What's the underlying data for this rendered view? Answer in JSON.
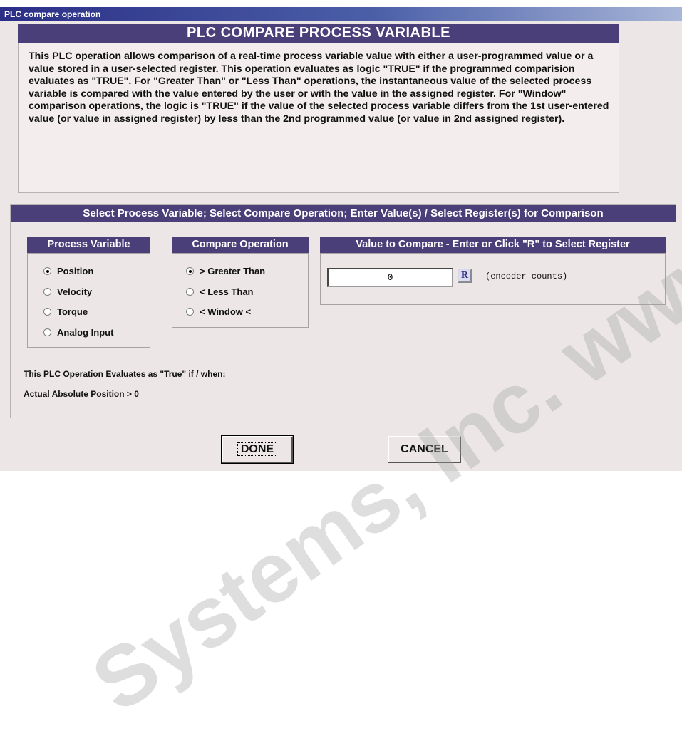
{
  "window": {
    "title": "PLC compare operation"
  },
  "banner": {
    "title": "PLC COMPARE PROCESS VARIABLE"
  },
  "description": "This PLC operation allows comparison of a real-time process variable value with either a user-programmed value or a value stored in a user-selected register.  This operation evaluates as logic \"TRUE\" if the programmed comparision evaluates as \"TRUE\".  For \"Greater Than\" or \"Less Than\" operations, the instantaneous value of the selected process variable is compared with the value entered by the user or with the value in the assigned register.  For \"Window\" comparison operations, the logic is \"TRUE\" if the value of the selected process variable differs from the 1st user-entered value (or value in assigned register) by less than the 2nd programmed value (or value in 2nd assigned register).",
  "section": {
    "header": "Select Process Variable; Select Compare Operation; Enter Value(s) / Select Register(s) for Comparison"
  },
  "process_variable": {
    "title": "Process Variable",
    "options": [
      "Position",
      "Velocity",
      "Torque",
      "Analog Input"
    ],
    "selected": "Position"
  },
  "compare_operation": {
    "title": "Compare Operation",
    "options": [
      "> Greater Than",
      "< Less Than",
      "< Window <"
    ],
    "selected": "> Greater Than"
  },
  "value_to_compare": {
    "title": "Value to Compare - Enter or Click \"R\" to Select Register",
    "value": "0",
    "register_button": "R",
    "units": "(encoder counts)"
  },
  "evaluation": {
    "label": "This PLC Operation Evaluates as \"True\" if / when:",
    "expression": "Actual Absolute Position > 0"
  },
  "buttons": {
    "done": "DONE",
    "cancel": "CANCEL"
  },
  "watermark": {
    "text": "Systems, Inc. www.alliedmotion"
  },
  "colors": {
    "header_bg": "#4b3f7a",
    "panel_bg": "#ece6e6",
    "titlebar": "#2b2f86"
  }
}
